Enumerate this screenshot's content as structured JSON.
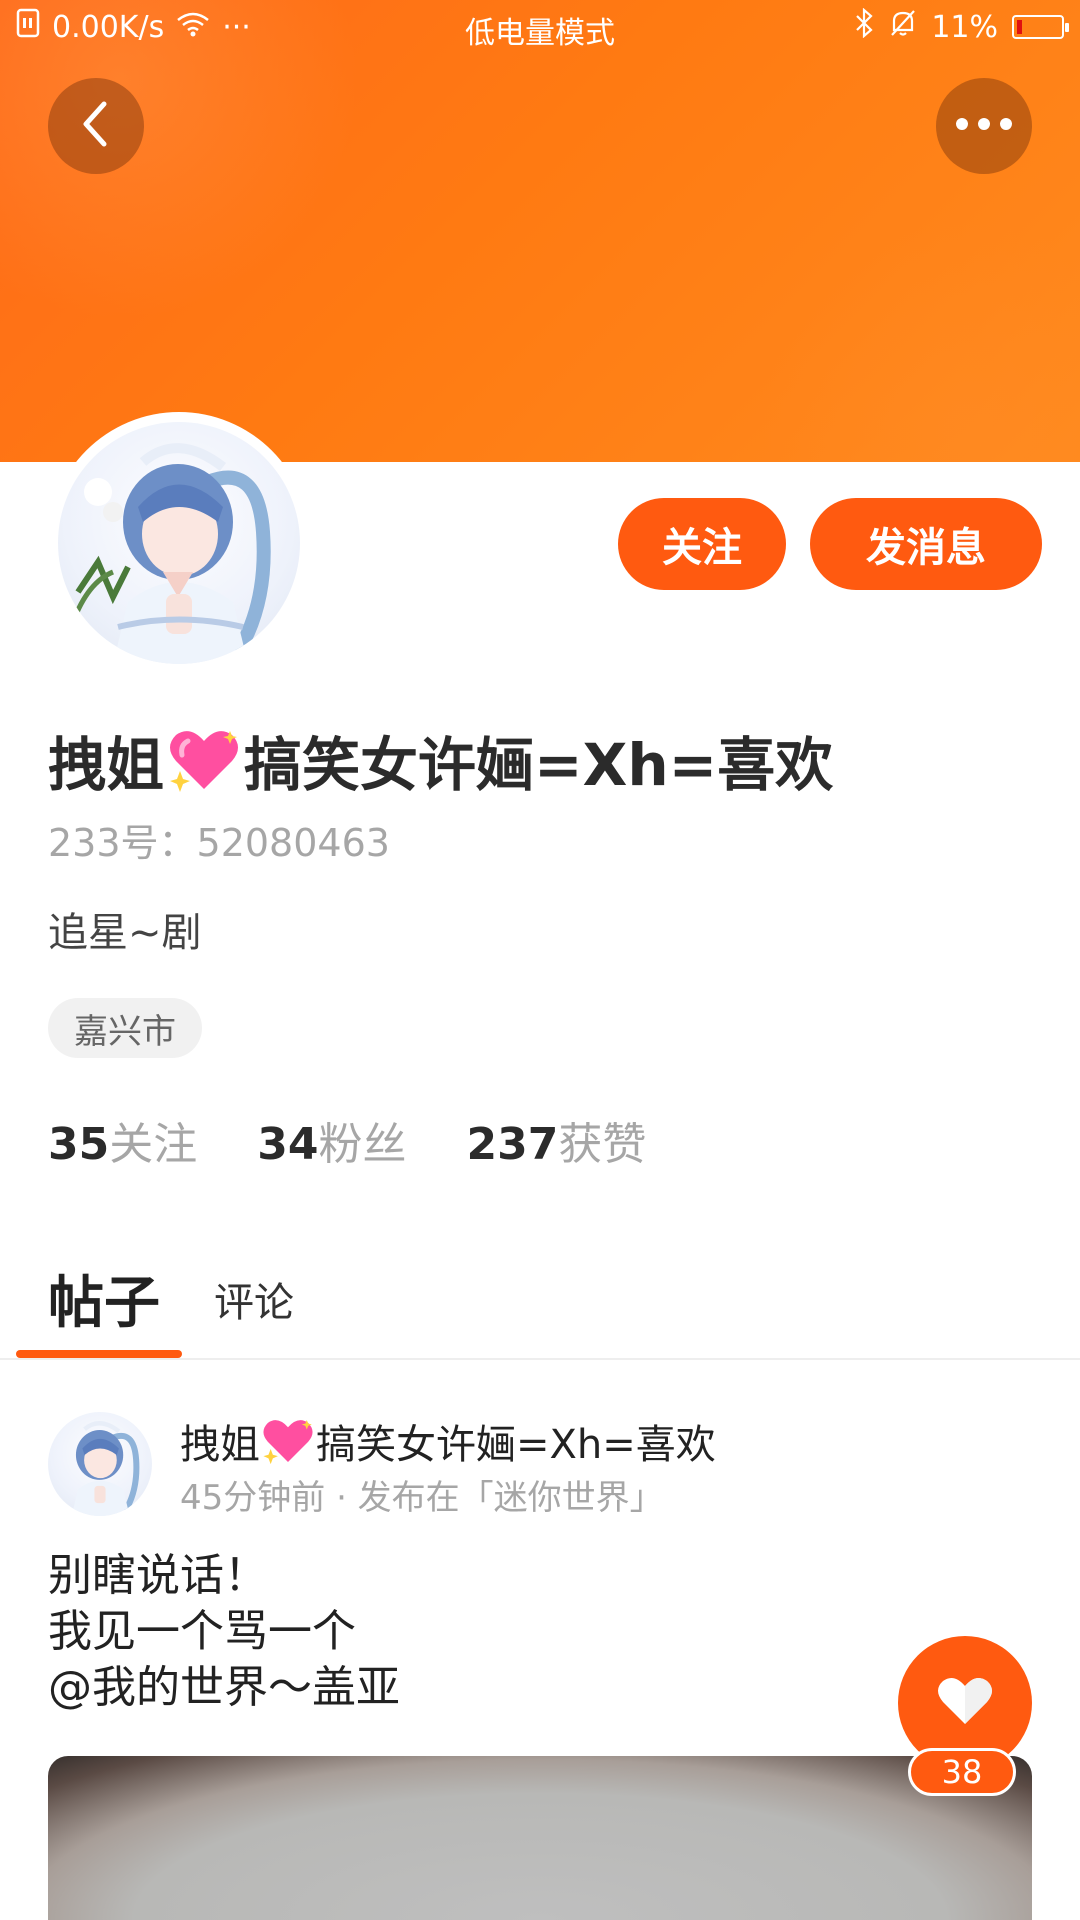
{
  "status_bar": {
    "net_speed": "0.00K/s",
    "dots": "···",
    "mode": "低电量模式",
    "battery": "11%",
    "battery_color": "#e01010"
  },
  "header": {
    "back_icon": "chevron-left-icon",
    "more_icon": "more-dots-icon"
  },
  "profile": {
    "name_part1": "拽姐",
    "name_part2": "搞笑女许婳=Xh=喜欢",
    "id_line": "233号：52080463",
    "bio": "追星~剧",
    "location": "嘉兴市",
    "follow_button": "关注",
    "message_button": "发消息",
    "stats": [
      {
        "num": "35",
        "label": "关注"
      },
      {
        "num": "34",
        "label": "粉丝"
      },
      {
        "num": "237",
        "label": "获赞"
      }
    ]
  },
  "tabs": {
    "posts": "帖子",
    "comments": "评论",
    "active": "帖子"
  },
  "post": {
    "author_part1": "拽姐",
    "author_part2": "搞笑女许婳=Xh=喜欢",
    "meta": "45分钟前 · 发布在「迷你世界」",
    "line1": "别瞎说话！",
    "line2": "我见一个骂一个",
    "line3": "@我的世界～盖亚",
    "like_count": "38"
  },
  "colors": {
    "accent": "#ff5a10",
    "banner": "#ff7a12"
  }
}
